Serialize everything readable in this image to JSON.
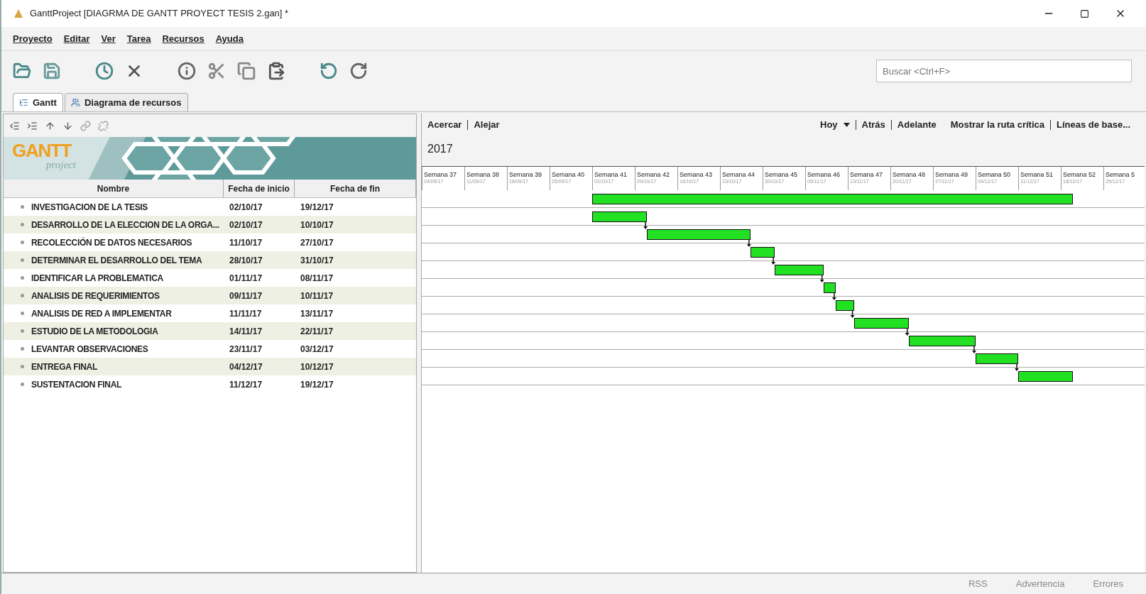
{
  "window": {
    "title": "GanttProject [DIAGRMA DE GANTT PROYECT TESIS 2.gan] *"
  },
  "menu": [
    "Proyecto",
    "Editar",
    "Ver",
    "Tarea",
    "Recursos",
    "Ayuda"
  ],
  "search": {
    "placeholder": "Buscar <Ctrl+F>"
  },
  "tabs": [
    {
      "label": "Gantt",
      "selected": true
    },
    {
      "label": "Diagrama de recursos",
      "selected": false
    }
  ],
  "logo": {
    "main": "GANTT",
    "sub": "project"
  },
  "table": {
    "columns": [
      "Nombre",
      "Fecha de inicio",
      "Fecha de fin"
    ],
    "rows": [
      {
        "name": "INVESTIGACION DE LA TESIS",
        "start": "02/10/17",
        "end": "19/12/17"
      },
      {
        "name": "DESARROLLO DE LA ELECCION DE LA ORGA...",
        "start": "02/10/17",
        "end": "10/10/17"
      },
      {
        "name": "RECOLECCIÓN DE DATOS NECESARIOS",
        "start": "11/10/17",
        "end": "27/10/17"
      },
      {
        "name": "DETERMINAR EL DESARROLLO DEL TEMA",
        "start": "28/10/17",
        "end": "31/10/17"
      },
      {
        "name": "IDENTIFICAR LA PROBLEMATICA",
        "start": "01/11/17",
        "end": "08/11/17"
      },
      {
        "name": "ANALISIS DE REQUERIMIENTOS",
        "start": "09/11/17",
        "end": "10/11/17"
      },
      {
        "name": "ANALISIS DE RED A IMPLEMENTAR",
        "start": "11/11/17",
        "end": "13/11/17"
      },
      {
        "name": "ESTUDIO DE LA METODOLOGIA",
        "start": "14/11/17",
        "end": "22/11/17"
      },
      {
        "name": "LEVANTAR OBSERVACIONES",
        "start": "23/11/17",
        "end": "03/12/17"
      },
      {
        "name": "ENTREGA FINAL",
        "start": "04/12/17",
        "end": "10/12/17"
      },
      {
        "name": "SUSTENTACION FINAL",
        "start": "11/12/17",
        "end": "19/12/17"
      }
    ]
  },
  "chart_toolbar": {
    "zoom": [
      "Acercar",
      "Alejar"
    ],
    "today": "Hoy",
    "nav": [
      "Atrás",
      "Adelante"
    ],
    "extra": [
      "Mostrar la ruta crítica",
      "Líneas de base..."
    ]
  },
  "year": "2017",
  "weeks": [
    {
      "label": "Semana 37",
      "date": "04/09/17"
    },
    {
      "label": "Semana 38",
      "date": "11/09/17"
    },
    {
      "label": "Semana 39",
      "date": "18/09/17"
    },
    {
      "label": "Semana 40",
      "date": "25/09/17"
    },
    {
      "label": "Semana 41",
      "date": "02/10/17"
    },
    {
      "label": "Semana 42",
      "date": "09/10/17"
    },
    {
      "label": "Semana 43",
      "date": "16/10/17"
    },
    {
      "label": "Semana 44",
      "date": "23/10/17"
    },
    {
      "label": "Semana 45",
      "date": "30/10/17"
    },
    {
      "label": "Semana 46",
      "date": "06/11/17"
    },
    {
      "label": "Semana 47",
      "date": "13/11/17"
    },
    {
      "label": "Semana 48",
      "date": "20/11/17"
    },
    {
      "label": "Semana 49",
      "date": "27/11/17"
    },
    {
      "label": "Semana 50",
      "date": "04/12/17"
    },
    {
      "label": "Semana 51",
      "date": "11/12/17"
    },
    {
      "label": "Semana 52",
      "date": "18/12/17"
    },
    {
      "label": "Semana 5",
      "date": "25/12/17"
    }
  ],
  "status_bar": [
    "RSS",
    "Advertencia",
    "Errores"
  ]
}
